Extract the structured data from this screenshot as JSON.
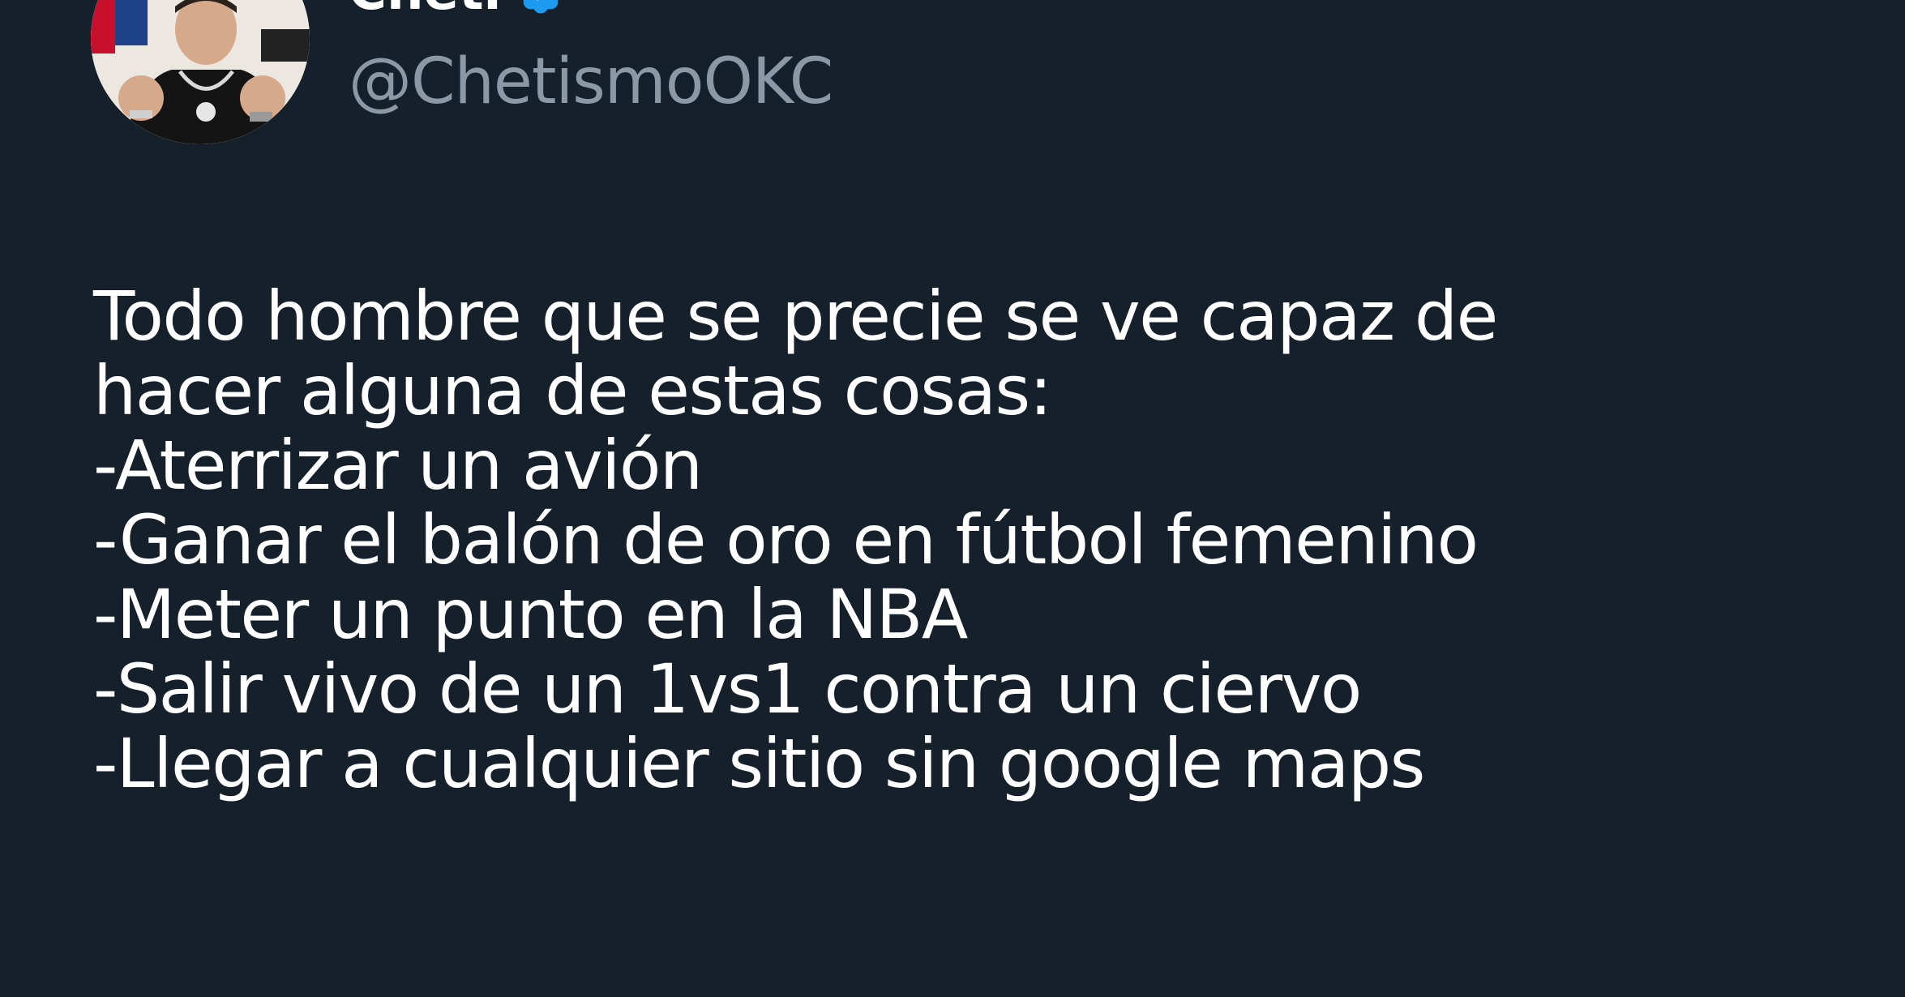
{
  "tweet": {
    "author": {
      "display_name": "Cheti",
      "handle": "@ChetismoOKC",
      "verified": true,
      "verified_color": "#1d9bf0",
      "avatar_icon": "profile-photo"
    },
    "more_icon": "more-options-icon",
    "text_lines": [
      "Todo hombre que se precie se ve capaz de",
      "hacer alguna de estas cosas:",
      "-Aterrizar un avión",
      "-Ganar el balón de oro en fútbol femenino",
      "-Meter un punto en la NBA",
      "-Salir vivo de un 1vs1 contra un ciervo",
      "-Llegar a cualquier sitio sin google maps"
    ]
  },
  "colors": {
    "background": "#15202b",
    "text": "#ffffff",
    "secondary_text": "#8b98a5",
    "accent": "#1d9bf0"
  }
}
